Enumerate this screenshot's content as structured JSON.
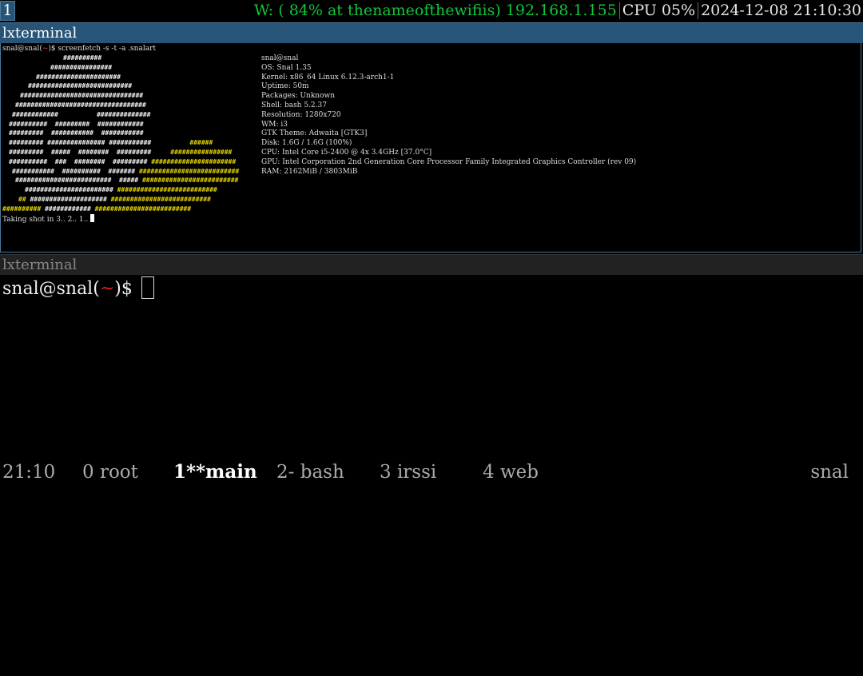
{
  "workspace": {
    "number": "1"
  },
  "status": {
    "wifi": "W: ( 84% at thenameofthewifiis) 192.168.1.155",
    "cpu": "CPU 05%",
    "datetime": "2024-12-08 21:10:30",
    "colors": {
      "wifi": "#11c43a",
      "workspace_active": "#285577"
    }
  },
  "top_window": {
    "title": "lxterminal",
    "prompt_user": "snal@snal(",
    "prompt_dir": "~",
    "prompt_end": ")$ ",
    "command": "screenfetch -s -t -a .snalart",
    "ascii_art": [
      [
        [
          "##########",
          "w"
        ]
      ],
      [
        [
          "################",
          "w"
        ]
      ],
      [
        [
          "######################",
          "w"
        ]
      ],
      [
        [
          "###########################",
          "w"
        ]
      ],
      [
        [
          "################################",
          "w"
        ]
      ],
      [
        [
          "##################################",
          "w"
        ]
      ],
      [
        [
          "############          ##############",
          "w"
        ]
      ],
      [
        [
          "##########  #########  ############",
          "w"
        ]
      ],
      [
        [
          "#########  ###########  ###########",
          "w"
        ]
      ],
      [
        [
          "######### ############### ###########",
          "w"
        ],
        [
          "          ######",
          "y"
        ]
      ],
      [
        [
          "#########  #####  ########  #########",
          "w"
        ],
        [
          "     ################",
          "y"
        ]
      ],
      [
        [
          "##########  ###  ########  #########",
          "w"
        ],
        [
          " ######################",
          "y"
        ]
      ],
      [
        [
          "###########  ##########  #######",
          "w"
        ],
        [
          " ##########################",
          "y"
        ]
      ],
      [
        [
          "#########################  #####",
          "w"
        ],
        [
          " #########################",
          "y"
        ]
      ],
      [
        [
          "#######################",
          "w"
        ],
        [
          " ##########################",
          "y"
        ]
      ],
      [
        [
          "##",
          "y"
        ],
        [
          " ####################",
          "w"
        ],
        [
          " ##########################",
          "y"
        ]
      ],
      [
        [
          "##########",
          "y"
        ],
        [
          " ############ ",
          "w"
        ],
        [
          "#########################",
          "y"
        ]
      ]
    ],
    "info_lines": [
      "snal@snal",
      "OS: Snal 1.35",
      "Kernel: x86_64 Linux 6.12.3-arch1-1",
      "Uptime: 50m",
      "Packages: Unknown",
      "Shell: bash 5.2.37",
      "Resolution: 1280x720",
      "WM: i3",
      "GTK Theme: Adwaita [GTK3]",
      "Disk: 1.6G / 1.6G (100%)",
      "CPU: Intel Core i5-2400 @ 4x 3.4GHz [37.0°C]",
      "GPU: Intel Corporation 2nd Generation Core Processor Family Integrated Graphics Controller (rev 09)",
      "RAM: 2162MiB / 3803MiB"
    ],
    "countdown": "Taking shot in 3.. 2.. 1.. "
  },
  "bottom_window": {
    "title": "lxterminal",
    "prompt_user": "snal@snal(",
    "prompt_dir": "~",
    "prompt_end": ")$ "
  },
  "tmux": {
    "clock": "21:10",
    "windows": [
      {
        "label": "0 root",
        "active": false
      },
      {
        "label": "1**main",
        "active": true
      },
      {
        "label": "2- bash",
        "active": false
      },
      {
        "label": "3 irssi",
        "active": false
      },
      {
        "label": "4 web",
        "active": false
      }
    ],
    "session": "snal"
  }
}
